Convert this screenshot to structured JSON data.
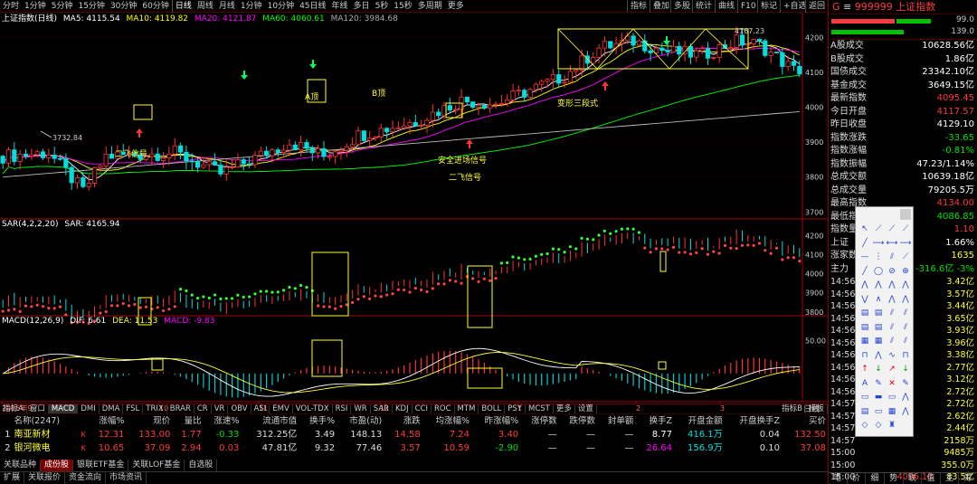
{
  "toolbar": {
    "items": [
      "分时",
      "1分钟",
      "5分钟",
      "15分钟",
      "30分钟",
      "60分钟",
      "日线",
      "周线",
      "月线",
      "1分钟",
      "10分钟",
      "45日线",
      "年线",
      "多日",
      "5秒",
      "15秒",
      "多周期",
      "更多"
    ],
    "right": [
      "指标",
      "叠加",
      "多股",
      "统计",
      "曲线",
      "F10",
      "标记",
      "+自选",
      "返回"
    ]
  },
  "main": {
    "name": "上证指数(日线)",
    "ma": [
      {
        "label": "MA5: 4115.54",
        "color": "#ffffff"
      },
      {
        "label": "MA10: 4119.82",
        "color": "#ffff00"
      },
      {
        "label": "MA20: 4121.87",
        "color": "#ff00ff"
      },
      {
        "label": "MA60: 4060.61",
        "color": "#00ff00"
      },
      {
        "label": "MA120: 3984.68",
        "color": "#aaaaaa"
      }
    ],
    "yticks": [
      4200,
      4100,
      4000,
      3900,
      3800,
      3700
    ],
    "annotations": {
      "low": "3732.84",
      "high": "4167.23",
      "a_peak": "A顶",
      "b_peak": "B顶",
      "erfei1": "二飞信号",
      "safe": "安全进场信号",
      "erfei2": "二飞信号",
      "trans": "变形三段式"
    }
  },
  "sar": {
    "label": "SAR(4,2,2,20)",
    "value": "SAR: 4165.94",
    "yticks": [
      4200,
      4100,
      4000,
      3900,
      3800
    ]
  },
  "macd": {
    "label": "MACD(12,26,9)",
    "dif": "DIF: 6.61",
    "dea": "DEA: 11.53",
    "macd": "MACD: -9.83",
    "yticks": [
      "50.00"
    ]
  },
  "xaxis": {
    "labels": [
      "2025年9",
      "10",
      "11",
      "12",
      "1",
      "2",
      "3"
    ],
    "right": "日线"
  },
  "tabs": [
    "指标A",
    "窗口",
    "MACD",
    "DMI",
    "DMA",
    "FSL",
    "TRIX",
    "BRAR",
    "CR",
    "VR",
    "OBV",
    "ASI",
    "EMV",
    "VOL-TDX",
    "RSI",
    "WR",
    "SAR",
    "KDJ",
    "CCI",
    "ROC",
    "MTM",
    "BOLL",
    "PSY",
    "MCST",
    "更多",
    "设置"
  ],
  "tabs_right": [
    "指标B",
    "模板"
  ],
  "table": {
    "headers": [
      "",
      "名称(2247)",
      "",
      "涨幅%",
      "现价",
      "量比",
      "涨速%",
      "流通市值",
      "换手%",
      "市盈(动)",
      "涨跌",
      "均涨幅%",
      "昨涨幅%",
      "涨停数",
      "跌停数",
      "封单额",
      "换手Z",
      "开盘金额",
      "开盘换手Z",
      "买价"
    ],
    "rows": [
      [
        "1",
        "南亚新材",
        "K",
        "12.31",
        "133.00",
        "1.77",
        "-0.33",
        "312.25亿",
        "3.49",
        "148.13",
        "14.58",
        "7.24",
        "3.40",
        "—",
        "—",
        "—",
        "8.77",
        "416.1万",
        "0.04",
        "132.50"
      ],
      [
        "2",
        "银河微电",
        "K",
        "10.65",
        "37.09",
        "2.94",
        "0.03",
        "47.81亿",
        "9.32",
        "77.46",
        "3.57",
        "10.59",
        "-2.90",
        "—",
        "—",
        "—",
        "26.64",
        "156.9万",
        "0.10",
        "37.08"
      ]
    ]
  },
  "btabs": [
    "关联品种",
    "成份股",
    "银联ETF基金",
    "关联LOF基金",
    "自选股"
  ],
  "status": [
    "扩展",
    "关联报价",
    "资金流向",
    "市场资讯"
  ],
  "right": {
    "code": "999999",
    "name": "上证指数",
    "top_vals": [
      "99.0",
      "139.0"
    ],
    "rows": [
      {
        "l": "A股成交",
        "v": "10628.56亿",
        "c": "white"
      },
      {
        "l": "B股成交",
        "v": "1.86亿",
        "c": "white"
      },
      {
        "l": "国债成交",
        "v": "23342.10亿",
        "c": "white"
      },
      {
        "l": "基金成交",
        "v": "3649.15亿",
        "c": "white"
      },
      {
        "l": "最新指数",
        "v": "4095.45",
        "c": "red"
      },
      {
        "l": "今日开盘",
        "v": "4117.57",
        "c": "red"
      },
      {
        "l": "昨日收盘",
        "v": "4129.10",
        "c": "white"
      },
      {
        "l": "指数涨跌",
        "v": "-33.65",
        "c": "green"
      },
      {
        "l": "指数涨幅",
        "v": "-0.81%",
        "c": "green"
      },
      {
        "l": "指数振幅",
        "v": "47.23/1.14%",
        "c": "white"
      },
      {
        "l": "总成交额",
        "v": "10639.18亿",
        "c": "white"
      },
      {
        "l": "总成交量",
        "v": "79205.5万",
        "c": "white"
      },
      {
        "l": "最高指数",
        "v": "4134.00",
        "c": "red"
      },
      {
        "l": "最低指数",
        "v": "4086.85",
        "c": "green"
      },
      {
        "l": "指数量比",
        "v": "1.10",
        "c": "red"
      },
      {
        "l": "上证",
        "v": "1.66%",
        "c": "white"
      }
    ],
    "updown": {
      "l": "涨家数",
      "v": "1635"
    },
    "main_force": {
      "l": "主力",
      "v1": "-316.6亿",
      "v2": "-3%"
    },
    "ticks": [
      {
        "t": "14:56",
        "p": "",
        "v": "3.42亿"
      },
      {
        "t": "14:56",
        "p": "",
        "v": "3.57亿"
      },
      {
        "t": "14:56",
        "p": "",
        "v": "3.44亿"
      },
      {
        "t": "14:56",
        "p": "",
        "v": "3.65亿"
      },
      {
        "t": "14:56",
        "p": "",
        "v": "3.93亿"
      },
      {
        "t": "14:56",
        "p": "",
        "v": "3.96亿"
      },
      {
        "t": "14:56",
        "p": "",
        "v": "3.38亿"
      },
      {
        "t": "14:56",
        "p": "",
        "v": "2.77亿"
      },
      {
        "t": "14:56",
        "p": "",
        "v": "3.12亿"
      },
      {
        "t": "14:56",
        "p": "",
        "v": "2.72亿"
      },
      {
        "t": "14:57",
        "p": "",
        "v": "2.72亿"
      },
      {
        "t": "14:57",
        "p": "",
        "v": "2.62亿"
      },
      {
        "t": "14:57",
        "p": "",
        "v": "2.44亿"
      },
      {
        "t": "14:57",
        "p": "",
        "v": "2158万"
      },
      {
        "t": "15:00",
        "p": "",
        "v": "9485万"
      },
      {
        "t": "15:00",
        "p": "",
        "v": "355.0万"
      },
      {
        "t": "15:00",
        "p": "4096.16",
        "v": "83.5亿"
      },
      {
        "t": "15:00",
        "p": "4095.45",
        "v": "28.0亿"
      }
    ],
    "bottom": [
      "笔",
      "价",
      "细",
      "势",
      "联",
      "值",
      "主",
      "筹"
    ]
  },
  "palette": {
    "icons": [
      "↖",
      "⟋",
      "⟋",
      "⟋",
      "╱",
      "⟶",
      "⟷",
      "⟶",
      "—",
      "⋮",
      "⫽",
      "⟋",
      "╱",
      "◯",
      "⊘",
      "⊕",
      "⋀",
      "⋀",
      "⋀",
      "⋀",
      "⋁",
      "∧",
      "⋀",
      "⋀",
      "▤",
      "▤",
      "⫽",
      "⫽",
      "▤",
      "▤",
      "⫽",
      "⫽",
      "▦",
      "▦",
      "⫽",
      "⫽",
      "⊓",
      "⋀",
      "∿",
      "⊓",
      "↑",
      "↓",
      "↗",
      "↓",
      "A",
      "✎",
      "✕",
      "✎",
      "▭",
      "▬",
      "▭",
      "⋀",
      "▤",
      "▭",
      "▦",
      "⋀",
      "◇",
      "◇",
      "♜",
      ""
    ]
  }
}
